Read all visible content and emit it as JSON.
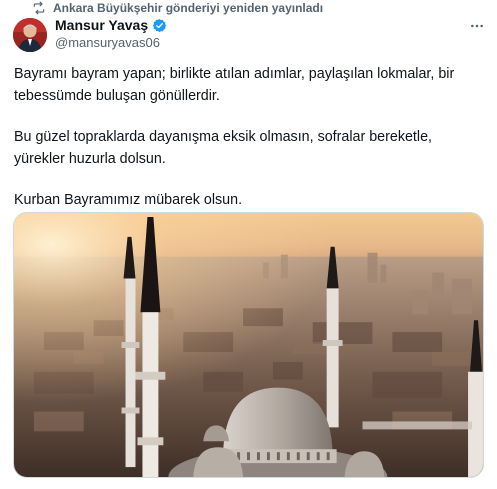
{
  "repost": {
    "text": "Ankara Büyükşehir gönderiyi yeniden yayınladı",
    "icon": "repost-icon"
  },
  "author": {
    "display_name": "Mansur Yavaş",
    "handle": "@mansuryavas06",
    "verified": true,
    "verified_icon": "verified-badge-icon",
    "verified_color": "#1d9bf0"
  },
  "more_icon": "more-horizontal-icon",
  "tweet": {
    "paragraphs": [
      [
        "Bayramı bayram yapan; birlikte atılan adımlar, paylaşılan lokmalar, bir",
        "tebessümde buluşan gönüllerdir."
      ],
      [
        "Bu güzel topraklarda dayanışma eksik olmasın, sofralar bereketle,",
        "yürekler huzurla dolsun."
      ],
      [
        "Kurban Bayramımız mübarek olsun."
      ]
    ]
  },
  "media": {
    "kind": "photo",
    "subject": "mosque-domes-and-minarets-over-city-at-sunrise"
  },
  "colors": {
    "text_primary": "#0f1419",
    "text_secondary": "#536471",
    "border": "#cfd9de"
  }
}
